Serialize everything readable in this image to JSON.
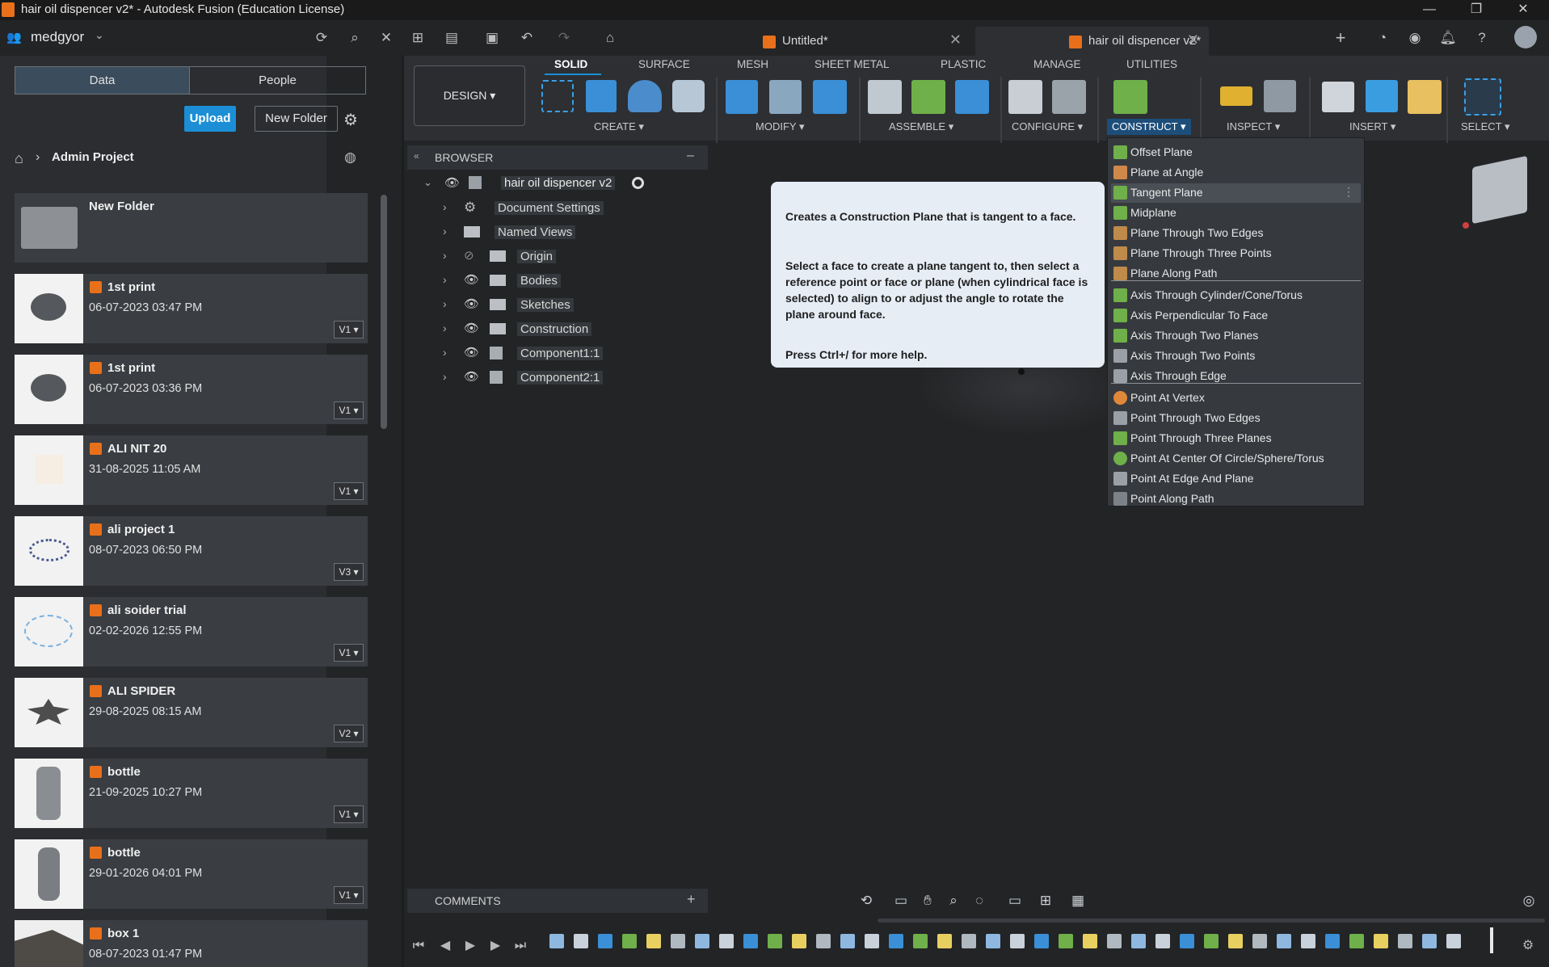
{
  "window": {
    "title": "hair oil dispencer v2* - Autodesk Fusion (Education License)",
    "controls": [
      "—",
      "❐",
      "✕"
    ]
  },
  "account": {
    "user": "medgyor"
  },
  "doc_tabs": [
    {
      "label": "Untitled*"
    },
    {
      "label": "hair oil dispencer v2*"
    }
  ],
  "data_panel": {
    "tabs": [
      "Data",
      "People"
    ],
    "upload_label": "Upload",
    "new_folder_label": "New Folder",
    "breadcrumb": "Admin Project",
    "folder": {
      "name": "New Folder"
    },
    "items": [
      {
        "name": "1st print",
        "date": "06-07-2023 03:47 PM",
        "version": "V1"
      },
      {
        "name": "1st print",
        "date": "06-07-2023 03:36 PM",
        "version": "V1"
      },
      {
        "name": "ALI NIT 20",
        "date": "31-08-2025 11:05 AM",
        "version": "V1"
      },
      {
        "name": "ali project 1",
        "date": "08-07-2023 06:50 PM",
        "version": "V3"
      },
      {
        "name": "ali soider trial",
        "date": "02-02-2026 12:55 PM",
        "version": "V1"
      },
      {
        "name": "ALI SPIDER",
        "date": "29-08-2025 08:15 AM",
        "version": "V2"
      },
      {
        "name": "bottle",
        "date": "21-09-2025 10:27 PM",
        "version": "V1"
      },
      {
        "name": "bottle",
        "date": "29-01-2026 04:01 PM",
        "version": "V1"
      },
      {
        "name": "box 1",
        "date": "08-07-2023 01:47 PM",
        "version": ""
      }
    ]
  },
  "toolbar": {
    "workspace": "DESIGN",
    "tabs": [
      "SOLID",
      "SURFACE",
      "MESH",
      "SHEET METAL",
      "PLASTIC",
      "MANAGE",
      "UTILITIES"
    ],
    "groups": [
      "CREATE",
      "MODIFY",
      "ASSEMBLE",
      "CONFIGURE",
      "CONSTRUCT",
      "INSPECT",
      "INSERT",
      "SELECT"
    ]
  },
  "browser": {
    "title": "BROWSER",
    "root": "hair oil dispencer v2",
    "nodes": [
      "Document Settings",
      "Named Views",
      "Origin",
      "Bodies",
      "Sketches",
      "Construction",
      "Component1:1",
      "Component2:1"
    ]
  },
  "tooltip": {
    "line1": "Creates a Construction Plane that is tangent to a face.",
    "line2": "Select a face to create a plane tangent to, then select a reference point or face or plane (when cylindrical face is selected) to align to or adjust the angle to rotate the plane around face.",
    "line3": "Press Ctrl+/ for more help."
  },
  "construct_menu": {
    "planes": [
      "Offset Plane",
      "Plane at Angle",
      "Tangent Plane",
      "Midplane",
      "Plane Through Two Edges",
      "Plane Through Three Points",
      "Plane Along Path"
    ],
    "axes": [
      "Axis Through Cylinder/Cone/Torus",
      "Axis Perpendicular To Face",
      "Axis Through Two Planes",
      "Axis Through Two Points",
      "Axis Through Edge"
    ],
    "points": [
      "Point At Vertex",
      "Point Through Two Edges",
      "Point Through Three Planes",
      "Point At Center Of Circle/Sphere/Torus",
      "Point At Edge And Plane",
      "Point Along Path"
    ],
    "highlighted": "Tangent Plane"
  },
  "comments": {
    "label": "COMMENTS"
  },
  "colors": {
    "accent": "#1b8ed6",
    "brand": "#e8701a",
    "menu_icon": "#6fb04a"
  }
}
